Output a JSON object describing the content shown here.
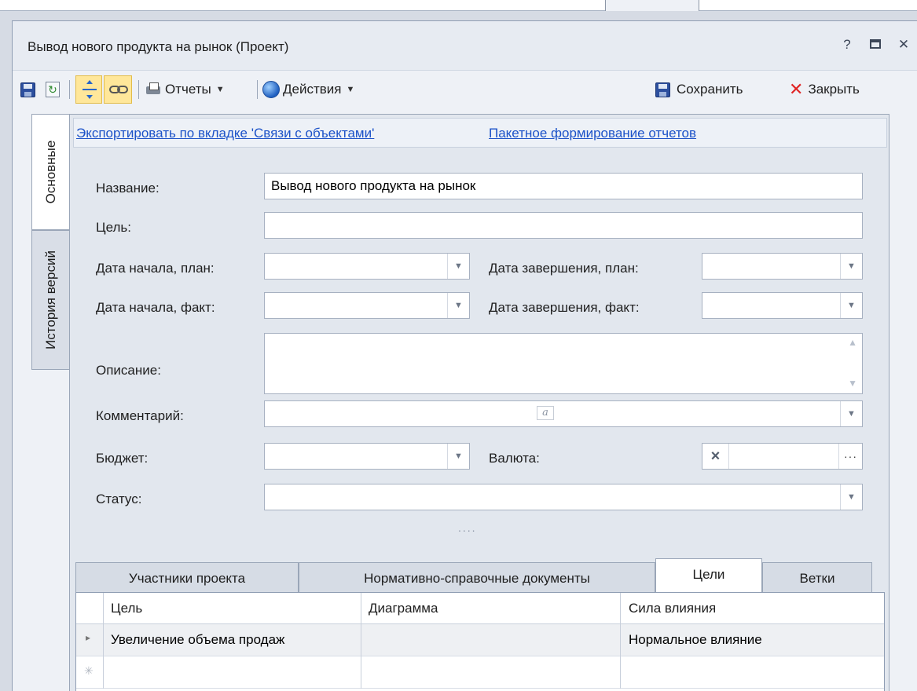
{
  "window": {
    "title": "Вывод нового продукта на рынок (Проект)",
    "help": "?",
    "close": "✕"
  },
  "toolbar": {
    "reports": "Отчеты",
    "actions": "Действия",
    "save": "Сохранить",
    "close": "Закрыть"
  },
  "side_tabs": [
    {
      "label": "Основные",
      "active": true
    },
    {
      "label": "История версий",
      "active": false
    }
  ],
  "links": {
    "export": "Экспортировать по вкладке 'Связи с объектами'",
    "batch": "Пакетное формирование отчетов"
  },
  "form": {
    "name_label": "Название:",
    "name_value": "Вывод нового продукта на рынок",
    "goal_label": "Цель:",
    "goal_value": "",
    "start_plan_label": "Дата начала, план:",
    "end_plan_label": "Дата завершения, план:",
    "start_fact_label": "Дата начала, факт:",
    "end_fact_label": "Дата завершения, факт:",
    "description_label": "Описание:",
    "comment_label": "Комментарий:",
    "comment_badge": "a",
    "budget_label": "Бюджет:",
    "currency_label": "Валюта:",
    "status_label": "Статус:"
  },
  "splitter": "....",
  "bottom_tabs": [
    {
      "label": "Участники проекта",
      "active": false
    },
    {
      "label": "Нормативно-справочные документы",
      "active": false
    },
    {
      "label": "Цели",
      "active": true
    },
    {
      "label": "Ветки",
      "active": false
    }
  ],
  "grid": {
    "columns": [
      "Цель",
      "Диаграмма",
      "Сила влияния"
    ],
    "rows": [
      {
        "goal": "Увеличение объема продаж",
        "diagram": "",
        "impact": "Нормальное влияние"
      }
    ],
    "new_row_marker": "✳",
    "current_row_marker": "▸"
  }
}
